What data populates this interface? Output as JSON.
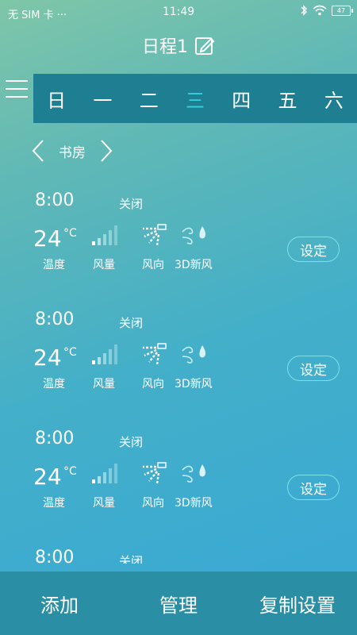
{
  "status_bar": {
    "carrier": "无 SIM 卡 ···",
    "time": "11:49",
    "battery": "47"
  },
  "header": {
    "title": "日程1"
  },
  "days": [
    "日",
    "一",
    "二",
    "三",
    "四",
    "五",
    "六"
  ],
  "active_day_index": 3,
  "room": {
    "name": "书房"
  },
  "schedules": [
    {
      "time": "8:00",
      "status": "关闭",
      "temperature": "24",
      "unit": "°C"
    },
    {
      "time": "8:00",
      "status": "关闭",
      "temperature": "24",
      "unit": "°C"
    },
    {
      "time": "8:00",
      "status": "关闭",
      "temperature": "24",
      "unit": "°C"
    }
  ],
  "partial_schedule": {
    "time": "8:00",
    "status": "关闭"
  },
  "labels": {
    "temp": "温度",
    "fan": "风量",
    "direction": "风向",
    "fresh": "3D新风",
    "set": "设定"
  },
  "bottom": {
    "add": "添加",
    "manage": "管理",
    "copy": "复制设置"
  },
  "colors": {
    "accent": "#35cfe0",
    "day_bar": "#1e7f92",
    "bottom_bar": "#2a8ea5"
  }
}
